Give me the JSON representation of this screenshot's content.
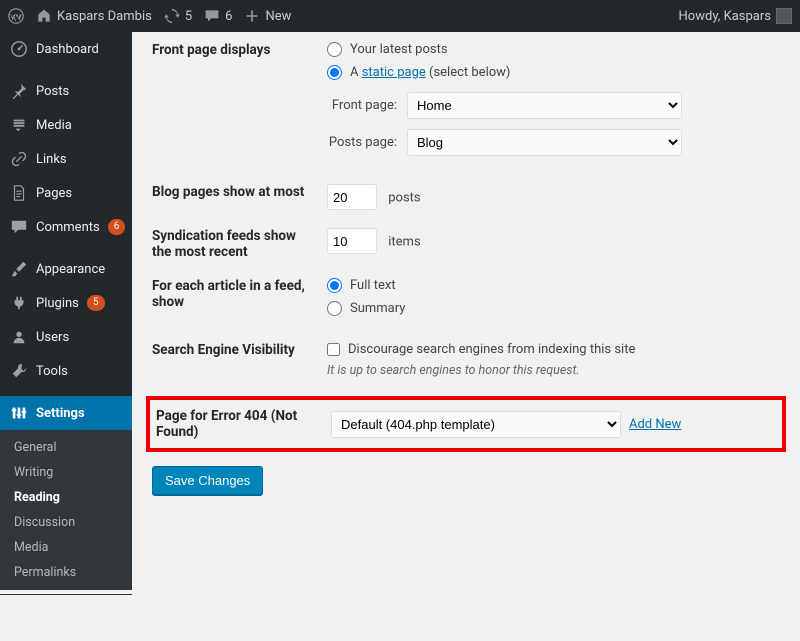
{
  "adminbar": {
    "site": "Kaspars Dambis",
    "updates": "5",
    "comments": "6",
    "new": "New",
    "howdy": "Howdy, Kaspars"
  },
  "sidebar": {
    "dashboard": "Dashboard",
    "posts": "Posts",
    "media": "Media",
    "links": "Links",
    "pages": "Pages",
    "comments": "Comments",
    "comments_badge": "6",
    "appearance": "Appearance",
    "plugins": "Plugins",
    "plugins_badge": "5",
    "users": "Users",
    "tools": "Tools",
    "settings": "Settings",
    "sub_general": "General",
    "sub_writing": "Writing",
    "sub_reading": "Reading",
    "sub_discussion": "Discussion",
    "sub_media": "Media",
    "sub_permalinks": "Permalinks",
    "collapse": "Collapse menu"
  },
  "form": {
    "front_page_displays": "Front page displays",
    "your_latest_posts": "Your latest posts",
    "a": "A ",
    "static_page": "static page",
    "select_below": " (select below)",
    "front_page_label": "Front page:",
    "front_page_value": "Home",
    "posts_page_label": "Posts page:",
    "posts_page_value": "Blog",
    "blog_pages_label": "Blog pages show at most",
    "blog_pages_value": "20",
    "posts_suffix": "posts",
    "syndication_label": "Syndication feeds show the most recent",
    "syndication_value": "10",
    "items_suffix": "items",
    "article_feed_label": "For each article in a feed, show",
    "full_text": "Full text",
    "summary": "Summary",
    "search_visibility_label": "Search Engine Visibility",
    "discourage": "Discourage search engines from indexing this site",
    "honor": "It is up to search engines to honor this request.",
    "error404_label": "Page for Error 404 (Not Found)",
    "error404_value": "Default (404.php template)",
    "add_new": "Add New",
    "save": "Save Changes"
  }
}
